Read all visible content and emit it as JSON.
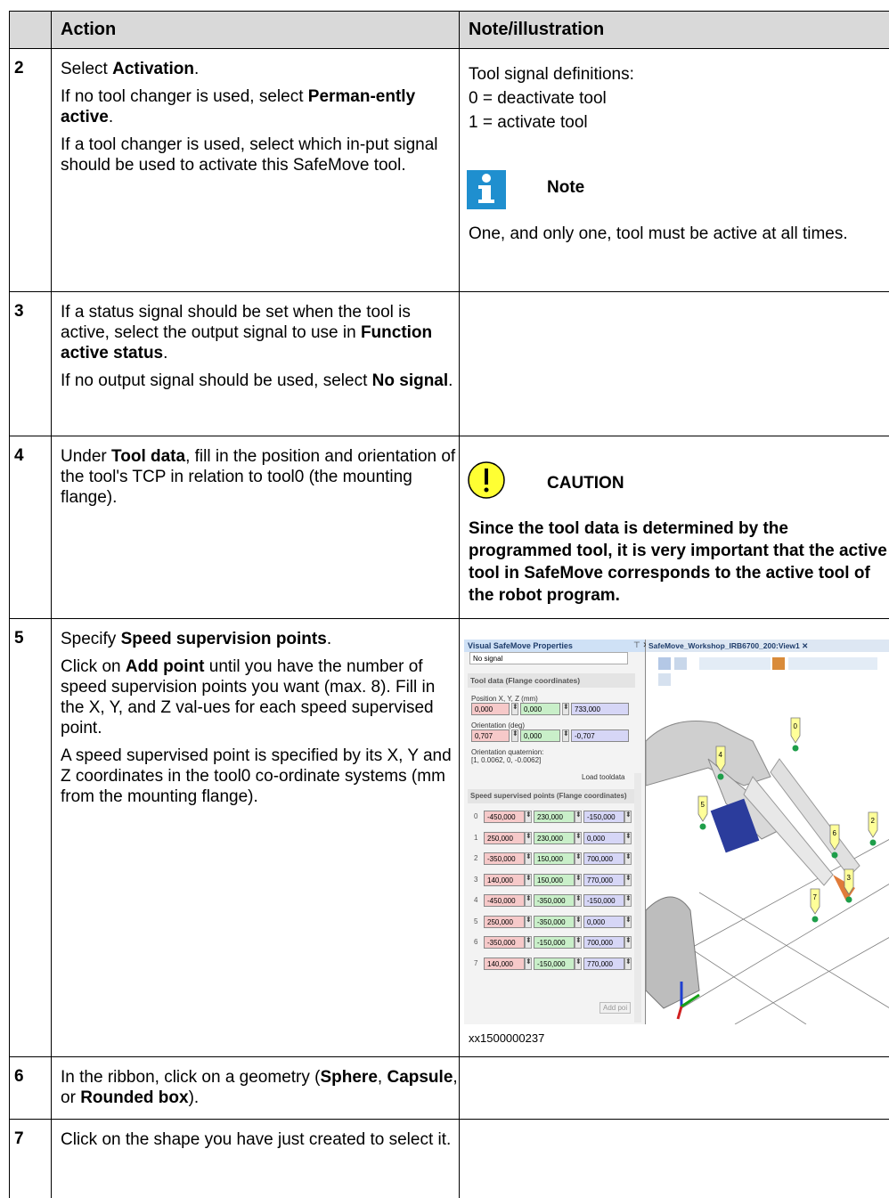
{
  "header": {
    "col_action": "Action",
    "col_note": "Note/illustration"
  },
  "rows": [
    {
      "step": "2",
      "action": [
        [
          "Select ",
          "Activation",
          "."
        ],
        [
          "If no tool changer is used, select ",
          "Perman-ently active",
          "."
        ],
        [
          "If a tool changer is used, select which in-put signal should be used to activate this SafeMove tool."
        ]
      ],
      "note_lines": [
        "Tool signal definitions:",
        "0 = deactivate tool",
        "1 = activate tool"
      ],
      "note_label": "Note",
      "note_text": "One, and only one, tool must be active at all times."
    },
    {
      "step": "3",
      "action": [
        [
          "If a status signal should be set when the tool is active, select the output signal to use in ",
          "Function active status",
          "."
        ],
        [
          "If no output signal should be used, select ",
          "No signal",
          "."
        ]
      ]
    },
    {
      "step": "4",
      "action": [
        [
          "Under ",
          "Tool data",
          ", fill in the position and orientation of the tool's TCP in relation to tool0 (the mounting flange)."
        ]
      ],
      "caution_label": "CAUTION",
      "caution_text": "Since the tool data is determined by the programmed tool, it is very important that the active tool in SafeMove corresponds to the active tool of the robot program."
    },
    {
      "step": "5",
      "action": [
        [
          "Specify ",
          "Speed supervision points",
          "."
        ],
        [
          "Click on ",
          "Add point",
          " until you have the number of speed supervision points you want (max. 8). Fill in the X, Y, and Z val-ues for each speed supervised point."
        ],
        [
          "A speed supervised point is specified by its X, Y and Z coordinates in the tool0 co-ordinate systems (mm from the mounting flange)."
        ]
      ],
      "caption": "xx1500000237"
    },
    {
      "step": "6",
      "action": [
        [
          "In the ribbon, click on a geometry (",
          "Sphere",
          ", ",
          "Capsule",
          ", or ",
          "Rounded box",
          ")."
        ]
      ]
    },
    {
      "step": "7",
      "action": [
        [
          "Click on the shape you have just created to select it."
        ]
      ]
    }
  ],
  "screenshot": {
    "panel_title": "Visual SafeMove Properties",
    "signal_value": "No signal",
    "tooldata_header": "Tool data (Flange coordinates)",
    "position_label": "Position X, Y, Z (mm)",
    "position": [
      "0,000",
      "0,000",
      "733,000"
    ],
    "orientation_label": "Orientation (deg)",
    "orientation": [
      "0,707",
      "0,000",
      "-0,707"
    ],
    "quaternion_label": "Orientation quaternion:",
    "quaternion_value": "[1, 0.0062, 0, -0.0062]",
    "load_button": "Load tooldata",
    "points_header": "Speed supervised points (Flange coordinates)",
    "points": [
      [
        "0",
        "-450,000",
        "230,000",
        "-150,000"
      ],
      [
        "1",
        "250,000",
        "230,000",
        "0,000"
      ],
      [
        "2",
        "-350,000",
        "150,000",
        "700,000"
      ],
      [
        "3",
        "140,000",
        "150,000",
        "770,000"
      ],
      [
        "4",
        "-450,000",
        "-350,000",
        "-150,000"
      ],
      [
        "5",
        "250,000",
        "-350,000",
        "0,000"
      ],
      [
        "6",
        "-350,000",
        "-150,000",
        "700,000"
      ],
      [
        "7",
        "140,000",
        "-150,000",
        "770,000"
      ]
    ],
    "add_button": "Add poi",
    "view_title": "SafeMove_Workshop_IRB6700_200:View1",
    "view_markers": [
      "0",
      "4",
      "5",
      "6",
      "2",
      "3",
      "7"
    ]
  },
  "colors": {
    "header_bg": "#d9d9d9",
    "note_icon": "#1f8fcf",
    "caution_icon": "#ffff33"
  }
}
